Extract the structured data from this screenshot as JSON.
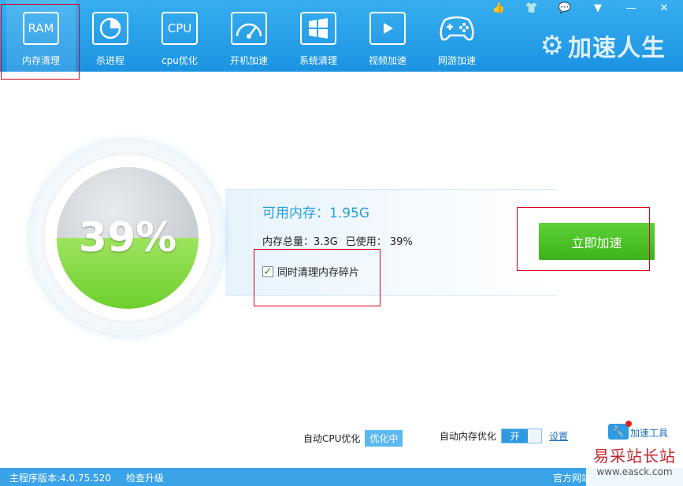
{
  "nav": [
    {
      "icon_text": "RAM",
      "label": "内存清理",
      "icon": "ram-icon"
    },
    {
      "icon_text": "",
      "label": "杀进程",
      "icon": "pie-chart-icon"
    },
    {
      "icon_text": "CPU",
      "label": "cpu优化",
      "icon": "cpu-icon"
    },
    {
      "icon_text": "",
      "label": "开机加速",
      "icon": "speedometer-icon"
    },
    {
      "icon_text": "",
      "label": "系统清理",
      "icon": "windows-icon"
    },
    {
      "icon_text": "",
      "label": "视频加速",
      "icon": "play-icon"
    },
    {
      "icon_text": "",
      "label": "网游加速",
      "icon": "gamepad-icon"
    }
  ],
  "brand": "加速人生",
  "memory": {
    "available_label": "可用内存：1.95G",
    "total": "内存总量：3.3G",
    "used": "已使用： 39%",
    "percent_text": "39%",
    "percent": 39,
    "defrag_label": "同时清理内存碎片",
    "defrag_checked": true
  },
  "speed_button": "立即加速",
  "auto_cpu": {
    "label": "自动CPU优化",
    "state": "优化中"
  },
  "auto_mem": {
    "label": "自动内存优化",
    "toggle": "开",
    "settings": "设置"
  },
  "tools": "加速工具",
  "status": {
    "version": "主程序版本:4.0.75.520",
    "update": "检查升级",
    "site": "官方网站"
  },
  "watermark": {
    "cn": "易采站长站",
    "en": "www.easck.com"
  },
  "colors": {
    "header": "#1b93e2",
    "accent": "#2a9fde",
    "button": "#3cb318",
    "highlight": "#d9001b"
  }
}
